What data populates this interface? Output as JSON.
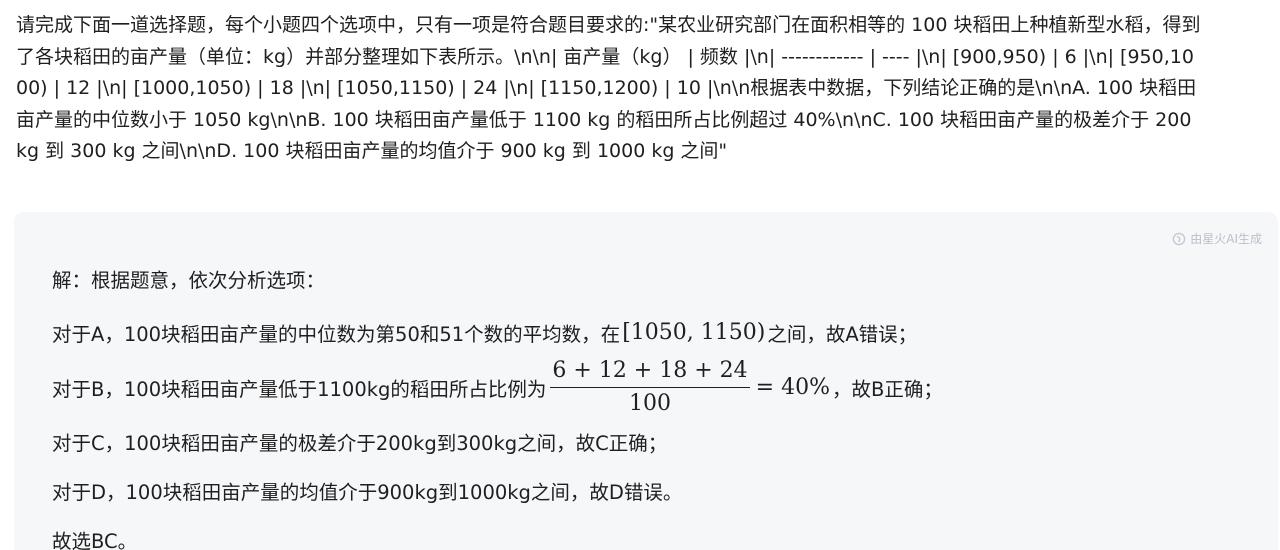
{
  "question": {
    "text": "请完成下面一道选择题，每个小题四个选项中，只有一项是符合题目要求的:\"某农业研究部门在面积相等的 100 块稻田上种植新型水稻，得到了各块稻田的亩产量（单位：kg）并部分整理如下表所示。\\n\\n| 亩产量（kg） | 频数 |\\n| ------------ | ---- |\\n| [900,950)    | 6    |\\n| [950,1000)   | 12   |\\n| [1000,1050)  | 18   |\\n| [1050,1150)  | 24   |\\n| [1150,1200)  | 10   |\\n\\n根据表中数据，下列结论正确的是\\n\\nA. 100 块稻田亩产量的中位数小于 1050 kg\\n\\nB. 100 块稻田亩产量低于 1100 kg 的稻田所占比例超过 40%\\n\\nC. 100 块稻田亩产量的极差介于 200 kg 到 300 kg 之间\\n\\nD. 100 块稻田亩产量的均值介于 900 kg 到 1000 kg 之间\""
  },
  "badge": {
    "label": "由星火AI生成",
    "icon": "spark-logo-icon"
  },
  "answer": {
    "intro": "解：根据题意，依次分析选项：",
    "a_prefix": "对于A，100块稻田亩产量的中位数为第50和51个数的平均数，在",
    "a_math": "[1050, 1150)",
    "a_suffix": "之间，故A错误；",
    "b_prefix": "对于B，100块稻田亩产量低于1100kg的稻田所占比例为",
    "b_num": "6 + 12 + 18 + 24",
    "b_den": "100",
    "b_result": "= 40%",
    "b_suffix": "，故B正确；",
    "c_line": "对于C，100块稻田亩产量的极差介于200kg到300kg之间，故C正确；",
    "d_line": "对于D，100块稻田亩产量的均值介于900kg到1000kg之间，故D错误。",
    "conclusion": "故选BC。"
  }
}
